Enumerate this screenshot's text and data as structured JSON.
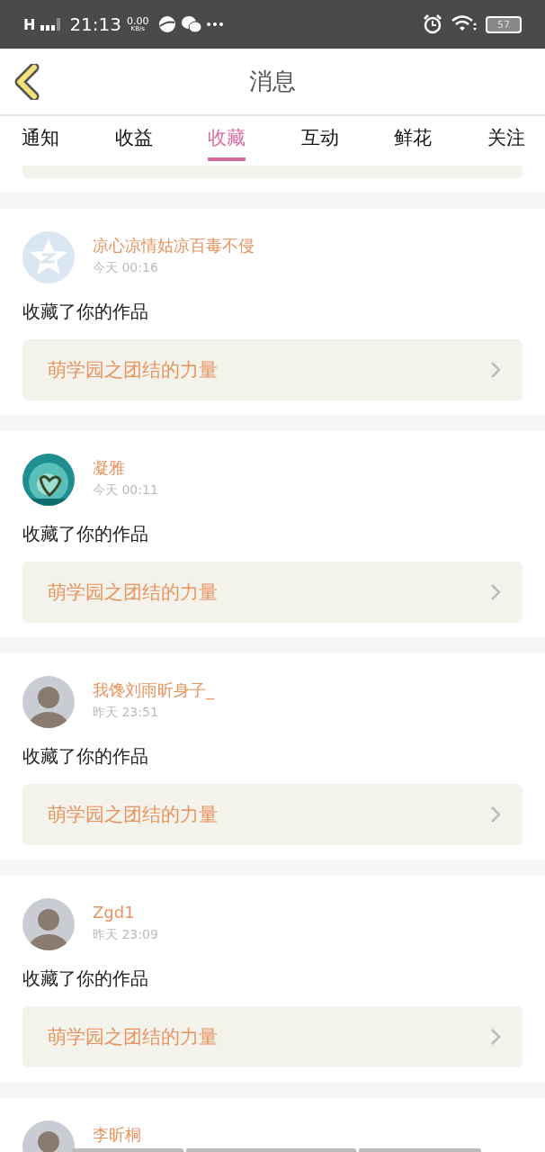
{
  "status_bar": {
    "network": "H",
    "time": "21:13",
    "speed": "0.00",
    "speed_unit": "KB/s",
    "battery": "57"
  },
  "header": {
    "title": "消息"
  },
  "tabs": [
    {
      "label": "通知",
      "selected": false
    },
    {
      "label": "收益",
      "selected": false
    },
    {
      "label": "收藏",
      "selected": true
    },
    {
      "label": "互动",
      "selected": false
    },
    {
      "label": "鲜花",
      "selected": false
    },
    {
      "label": "关注",
      "selected": false
    }
  ],
  "messages": [
    {
      "kind": "star",
      "name": "凉心凉情姑凉百毒不侵",
      "time": "今天 00:16",
      "action": "收藏了你的作品",
      "work": "萌学园之团结的力量"
    },
    {
      "kind": "picture",
      "name": "凝雅",
      "time": "今天 00:11",
      "action": "收藏了你的作品",
      "work": "萌学园之团结的力量"
    },
    {
      "kind": "person",
      "name": "我馋刘雨昕身子_",
      "time": "昨天 23:51",
      "action": "收藏了你的作品",
      "work": "萌学园之团结的力量"
    },
    {
      "kind": "person",
      "name": "Zgd1",
      "time": "昨天 23:09",
      "action": "收藏了你的作品",
      "work": "萌学园之团结的力量"
    },
    {
      "kind": "person",
      "name": "李昕桐"
    }
  ]
}
